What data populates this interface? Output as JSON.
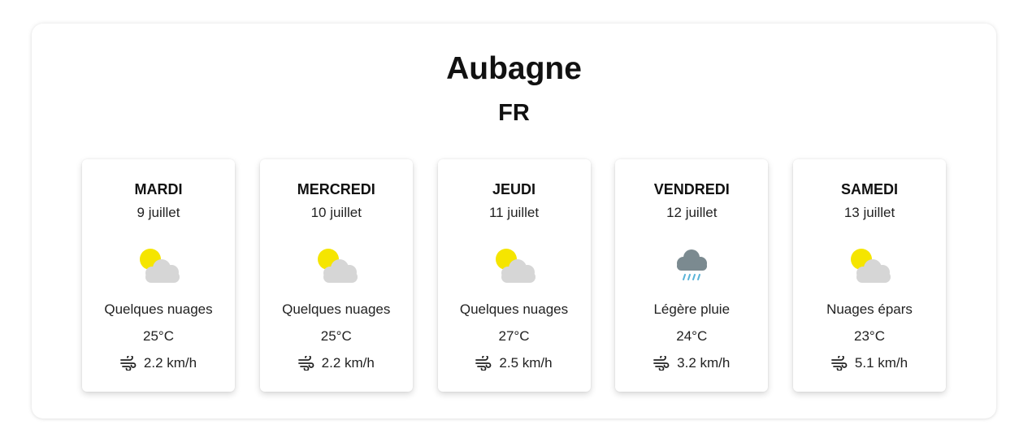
{
  "location": {
    "city": "Aubagne",
    "country": "FR"
  },
  "forecast": [
    {
      "day": "MARDI",
      "date": "9 juillet",
      "icon": "partly-cloudy-icon",
      "description": "Quelques nuages",
      "temperature": "25°C",
      "wind": "2.2 km/h"
    },
    {
      "day": "MERCREDI",
      "date": "10 juillet",
      "icon": "partly-cloudy-icon",
      "description": "Quelques nuages",
      "temperature": "25°C",
      "wind": "2.2 km/h"
    },
    {
      "day": "JEUDI",
      "date": "11 juillet",
      "icon": "partly-cloudy-icon",
      "description": "Quelques nuages",
      "temperature": "27°C",
      "wind": "2.5 km/h"
    },
    {
      "day": "VENDREDI",
      "date": "12 juillet",
      "icon": "rain-cloud-icon",
      "description": "Légère pluie",
      "temperature": "24°C",
      "wind": "3.2 km/h"
    },
    {
      "day": "SAMEDI",
      "date": "13 juillet",
      "icon": "partly-cloudy-icon",
      "description": "Nuages épars",
      "temperature": "23°C",
      "wind": "5.1 km/h"
    }
  ],
  "colors": {
    "sun": "#f5e500",
    "cloud": "#d6d6d6",
    "rain_cloud": "#7b8a90",
    "rain_drops": "#5ab4d8"
  }
}
